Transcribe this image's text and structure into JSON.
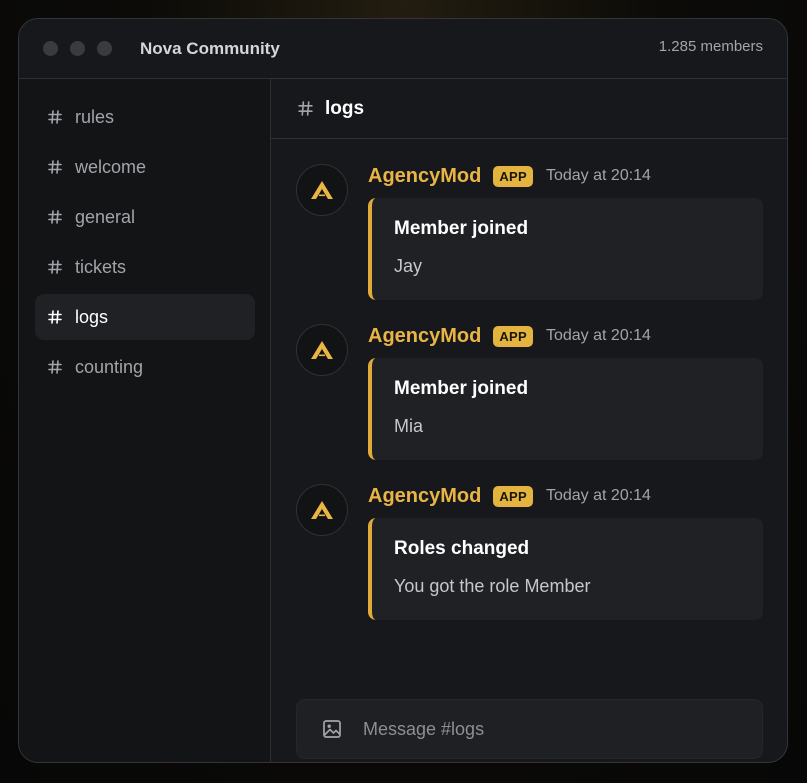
{
  "window": {
    "title": "Nova Community",
    "member_count": "1.285 members"
  },
  "sidebar": {
    "channels": [
      {
        "name": "rules"
      },
      {
        "name": "welcome"
      },
      {
        "name": "general"
      },
      {
        "name": "tickets"
      },
      {
        "name": "logs",
        "active": true
      },
      {
        "name": "counting"
      }
    ]
  },
  "channel": {
    "name": "logs"
  },
  "messages": [
    {
      "author": "AgencyMod",
      "badge": "APP",
      "time": "Today at 20:14",
      "embed": {
        "title": "Member joined",
        "description": "Jay"
      }
    },
    {
      "author": "AgencyMod",
      "badge": "APP",
      "time": "Today at 20:14",
      "embed": {
        "title": "Member joined",
        "description": "Mia"
      }
    },
    {
      "author": "AgencyMod",
      "badge": "APP",
      "time": "Today at 20:14",
      "embed": {
        "title": "Roles changed",
        "description": "You got the role Member"
      }
    }
  ],
  "composer": {
    "placeholder": "Message #logs",
    "icon": "image-icon"
  },
  "colors": {
    "accent": "#e9b544",
    "embed_bar": "#e0ab3a",
    "window_bg": "#17181b",
    "sidebar_bg": "#131416"
  }
}
